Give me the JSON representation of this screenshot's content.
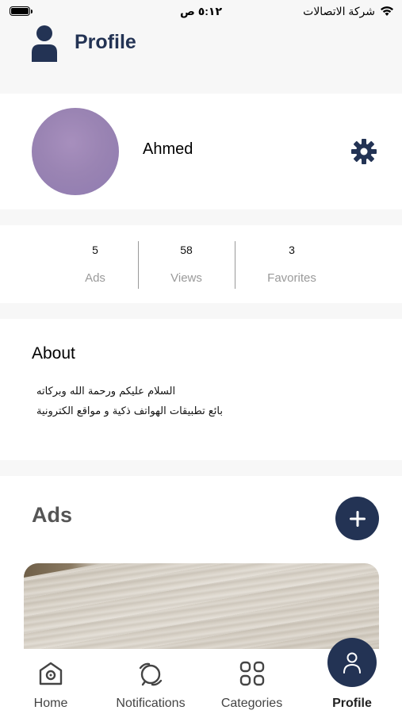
{
  "status_bar": {
    "time": "٥:١٢ ص",
    "carrier": "شركة الاتصالات"
  },
  "header": {
    "title": "Profile",
    "icon": "person-icon",
    "color": "#233354"
  },
  "profile": {
    "name": "Ahmed",
    "settings_icon": "gear-icon"
  },
  "stats": [
    {
      "value": "5",
      "label": "Ads"
    },
    {
      "value": "58",
      "label": "Views"
    },
    {
      "value": "3",
      "label": "Favorites"
    }
  ],
  "about": {
    "title": "About",
    "lines": [
      "السلام عليكم ورحمة الله وبركاته",
      "بائع تطبيقات الهواتف ذكية و مواقع الكترونية"
    ]
  },
  "ads": {
    "title": "Ads",
    "add_icon": "plus-icon"
  },
  "tab_bar": {
    "items": [
      {
        "label": "Home",
        "icon": "home-icon"
      },
      {
        "label": "Notifications",
        "icon": "notifications-icon"
      },
      {
        "label": "Categories",
        "icon": "grid-icon"
      },
      {
        "label": "Profile",
        "icon": "person-icon",
        "active": true
      }
    ]
  }
}
